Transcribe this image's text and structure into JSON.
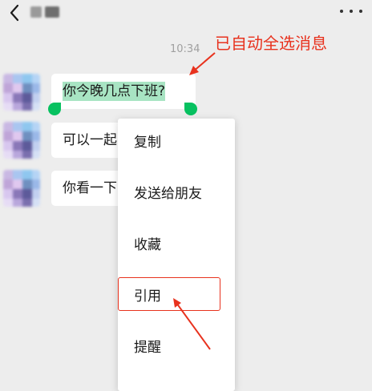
{
  "colors": {
    "background": "#ededed",
    "bubble": "#ffffff",
    "selection": "#a8e4c3",
    "handle": "#07c160",
    "annotation": "#e8321e",
    "timestamp": "#a0a0a0"
  },
  "header": {
    "back_icon": "chevron-left-icon",
    "more_icon": "more-dots-icon"
  },
  "timestamp": "10:34",
  "annotation": "已自动全选消息",
  "messages": [
    {
      "text": "你今晚几点下班?"
    },
    {
      "text": "可以一起"
    },
    {
      "text": "你看一下"
    }
  ],
  "menu": {
    "items": [
      {
        "label": "复制"
      },
      {
        "label": "发送给朋友"
      },
      {
        "label": "收藏"
      },
      {
        "label": "引用"
      },
      {
        "label": "提醒"
      }
    ]
  }
}
